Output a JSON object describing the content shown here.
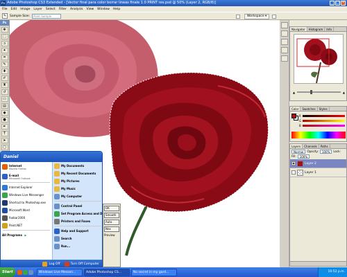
{
  "window": {
    "title": "Adobe Photoshop CS3 Extended - [Vector final para color borrar lineas finale 1.0   PRINT res.psd @ 50% (Layer 2, RGB/8)]",
    "app_icon": "Ps"
  },
  "menu": [
    "File",
    "Edit",
    "Image",
    "Layer",
    "Select",
    "Filter",
    "Analysis",
    "View",
    "Window",
    "Help"
  ],
  "options_bar": {
    "sample_size_label": "Sample Size:",
    "sample_size_value": "Point Sample",
    "workspace_label": "Workspace ▾"
  },
  "toolbox": {
    "label": "Ps"
  },
  "panels": {
    "navigator": {
      "tabs": [
        "Navigator",
        "Histogram",
        "Info"
      ]
    },
    "color": {
      "tabs": [
        "Color",
        "Swatches",
        "Styles"
      ],
      "fg_color": "#b40a14"
    },
    "layers": {
      "tabs": [
        "Layers",
        "Channels",
        "Paths"
      ],
      "blend": "Normal",
      "opacity_label": "Opacity:",
      "opacity": "100%",
      "lock_label": "Lock:",
      "fill_label": "Fill:",
      "fill": "100%",
      "rows": [
        {
          "name": "Layer 2",
          "active": true
        },
        {
          "name": "Layer 1",
          "active": false
        }
      ]
    }
  },
  "start_menu": {
    "user": "Daniel",
    "pinned": [
      {
        "title": "Internet",
        "sub": "Mozilla Firefox",
        "icon": "firefox-icon",
        "color": "#e66000"
      },
      {
        "title": "E-mail",
        "sub": "Microsoft Outlook",
        "icon": "outlook-icon",
        "color": "#2a62c9"
      }
    ],
    "recent": [
      {
        "label": "Internet Explorer",
        "icon": "ie-icon",
        "color": "#2a7ad6"
      },
      {
        "label": "Windows Live Messenger",
        "icon": "messenger-icon",
        "color": "#3aa54a"
      },
      {
        "label": "Shortcut to Photoshop.exe",
        "icon": "photoshop-icon",
        "color": "#1c3a6e"
      },
      {
        "label": "Microsoft Word",
        "icon": "word-icon",
        "color": "#1d4fa0"
      },
      {
        "label": "foobar2000",
        "icon": "foobar-icon",
        "color": "#555555"
      },
      {
        "label": "Paint.NET",
        "icon": "paintnet-icon",
        "color": "#d0a020"
      }
    ],
    "all_programs": "All Programs",
    "places": [
      {
        "label": "My Documents",
        "icon": "folder-icon",
        "color": "#e8b840"
      },
      {
        "label": "My Recent Documents",
        "icon": "recent-docs-icon",
        "color": "#e8b840"
      },
      {
        "label": "My Pictures",
        "icon": "pictures-icon",
        "color": "#e8b840"
      },
      {
        "label": "My Music",
        "icon": "music-icon",
        "color": "#e8b840"
      },
      {
        "label": "My Computer",
        "icon": "computer-icon",
        "color": "#6a90c8"
      }
    ],
    "system": [
      {
        "label": "Control Panel",
        "icon": "control-panel-icon",
        "color": "#6a90c8"
      },
      {
        "label": "Set Program Access and Defaults",
        "icon": "defaults-icon",
        "color": "#3aa54a"
      },
      {
        "label": "Printers and Faxes",
        "icon": "printer-icon",
        "color": "#777777"
      }
    ],
    "help": [
      {
        "label": "Help and Support",
        "icon": "help-icon",
        "color": "#2a62c9"
      },
      {
        "label": "Search",
        "icon": "search-icon",
        "color": "#6a90c8"
      },
      {
        "label": "Run...",
        "icon": "run-icon",
        "color": "#6a90c8"
      }
    ],
    "log_off": "Log Off",
    "turn_off": "Turn Off Computer"
  },
  "dialog": {
    "buttons": [
      "OK",
      "Smooth",
      "Auto",
      "Nex"
    ],
    "preview": "Preview"
  },
  "taskbar": {
    "start": "Start",
    "tasks": [
      {
        "label": "Windows Live Messen...",
        "active": false
      },
      {
        "label": "Adobe Photoshop CS...",
        "active": true
      },
      {
        "label": "No secret in my gard...",
        "active": false
      }
    ],
    "clock": "10:52 p.m."
  }
}
